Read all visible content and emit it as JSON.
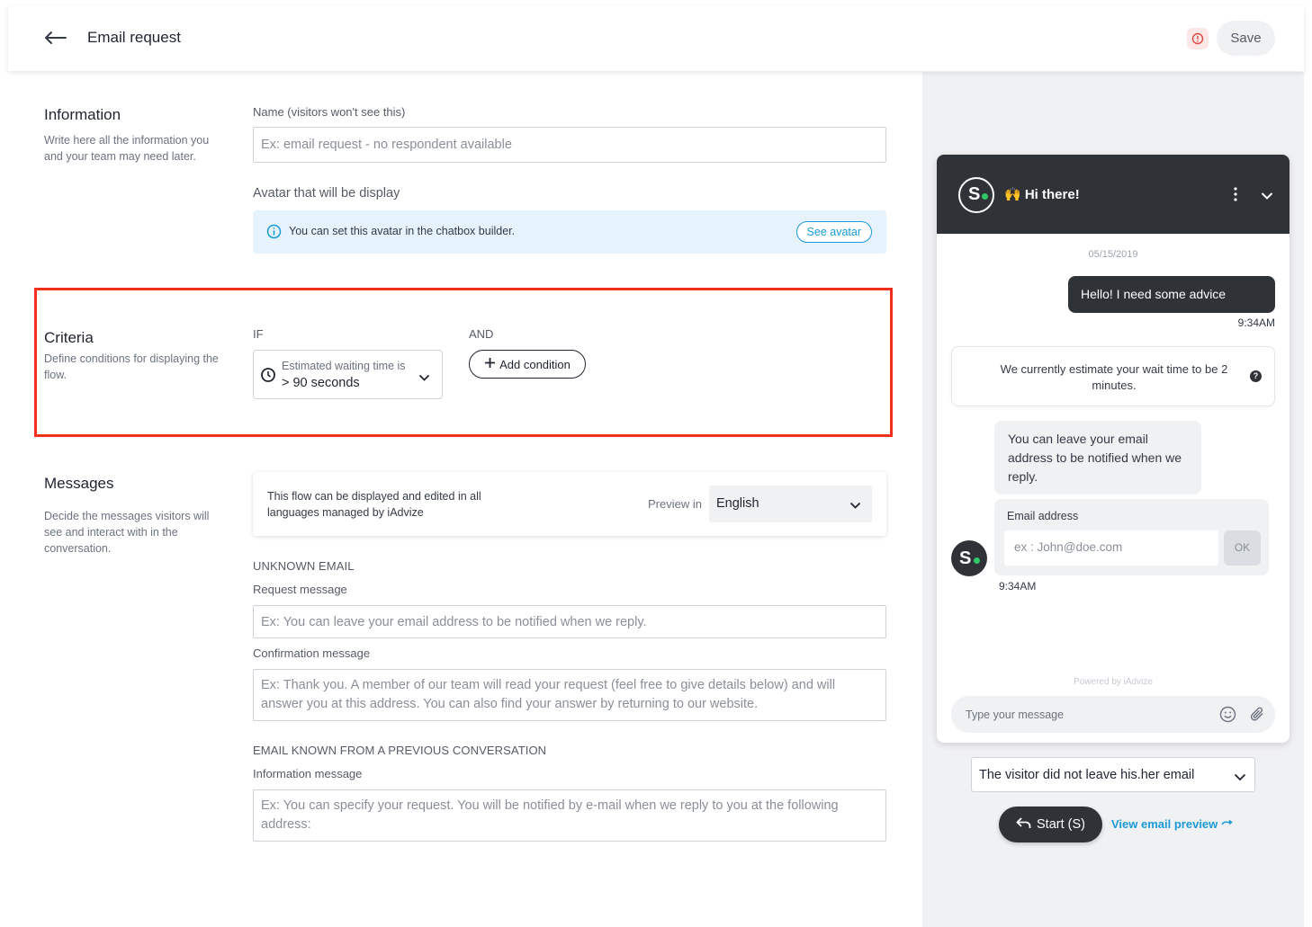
{
  "header": {
    "title": "Email request",
    "save_label": "Save"
  },
  "information": {
    "title": "Information",
    "description": "Write here all the information you and your team may need later.",
    "name_label": "Name (visitors won't see this)",
    "name_placeholder": "Ex: email request - no respondent available",
    "avatar_label": "Avatar that will be display",
    "avatar_info": "You can set this avatar in the chatbox builder.",
    "see_avatar_label": "See avatar"
  },
  "criteria": {
    "title": "Criteria",
    "description": "Define conditions for displaying the flow.",
    "if_label": "IF",
    "and_label": "AND",
    "condition_type": "Estimated waiting time is",
    "condition_value": "> 90 seconds",
    "add_condition_label": "Add condition"
  },
  "messages": {
    "title": "Messages",
    "description": "Decide the messages visitors will see and interact with in the conversation.",
    "language_note": "This flow can be displayed and edited in all languages managed by iAdvize",
    "preview_in_label": "Preview in",
    "preview_language": "English",
    "unknown_email_head": "UNKNOWN EMAIL",
    "request_label": "Request message",
    "request_placeholder": "Ex: You can leave your email address to be notified when we reply.",
    "confirmation_label": "Confirmation message",
    "confirmation_placeholder": "Ex: Thank you. A member of our team will read your request (feel free to give details below) and will answer you at this address. You can also find your answer by returning to our website.",
    "known_email_head": "EMAIL KNOWN FROM A PREVIOUS CONVERSATION",
    "information_label": "Information message",
    "information_placeholder": "Ex: You can specify your request. You will be notified by e-mail when we reply to you at the following address:"
  },
  "chat": {
    "greeting": "🙌 Hi there!",
    "date": "05/15/2019",
    "visitor_message": "Hello! I need some advice",
    "visitor_time": "9:34AM",
    "wait_message": "We currently estimate your wait time to be 2 minutes.",
    "bot_message": "You can leave your email address to be notified when we reply.",
    "email_label": "Email address",
    "email_placeholder": "ex : John@doe.com",
    "ok_label": "OK",
    "bot_time": "9:34AM",
    "powered_by": "Powered by iAdvize",
    "type_placeholder": "Type your message",
    "logo_letter": "S"
  },
  "preview_controls": {
    "scenario": "The visitor did not leave his.her email",
    "start_label": "Start (S)",
    "view_email_label": "View email preview"
  },
  "colors": {
    "accent": "#1a9ad6",
    "highlight": "#f2301b",
    "dark": "#2f3237",
    "online": "#2ec866"
  },
  "icons": [
    "back-arrow-icon",
    "alert-icon",
    "info-icon",
    "clock-icon",
    "chevron-down-icon",
    "plus-icon",
    "kebab-icon",
    "emoji-icon",
    "paperclip-icon",
    "reply-icon",
    "arrow-right-icon"
  ]
}
